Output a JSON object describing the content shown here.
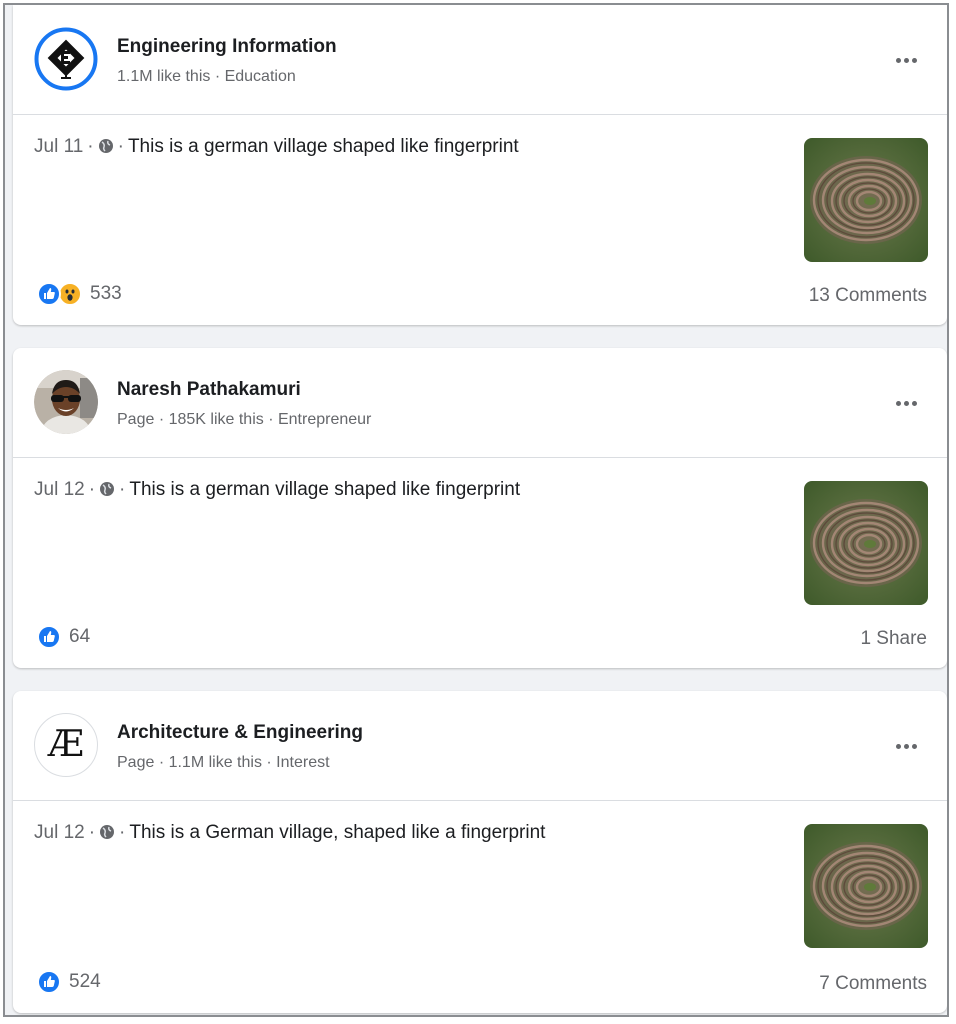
{
  "posts": [
    {
      "page_name": "Engineering Information",
      "meta": "1.1M like this · Education",
      "date": "Jul 11",
      "text": "This is a german village shaped like fingerprint",
      "reactions": [
        "like",
        "wow"
      ],
      "reaction_count": "533",
      "right_stat": "13 Comments"
    },
    {
      "page_name": "Naresh Pathakamuri",
      "meta": "Page · 185K like this · Entrepreneur",
      "date": "Jul 12",
      "text": "This is a german village shaped like fingerprint",
      "reactions": [
        "like"
      ],
      "reaction_count": "64",
      "right_stat": "1 Share"
    },
    {
      "page_name": "Architecture & Engineering",
      "avatar_letters": "Æ",
      "meta": "Page · 1.1M like this · Interest",
      "date": "Jul 12",
      "text": "This is a German village, shaped like a fingerprint",
      "reactions": [
        "like"
      ],
      "reaction_count": "524",
      "right_stat": "7 Comments"
    }
  ],
  "separator": "·",
  "icons": {
    "more": "more-options-icon",
    "globe": "globe-icon",
    "like": "like-reaction-icon",
    "wow": "wow-reaction-icon"
  },
  "colors": {
    "like_blue": "#1877f2",
    "wow_yellow": "#f7b125",
    "ei_logo_blue": "#1877f2",
    "secondary_text": "#65676b"
  }
}
